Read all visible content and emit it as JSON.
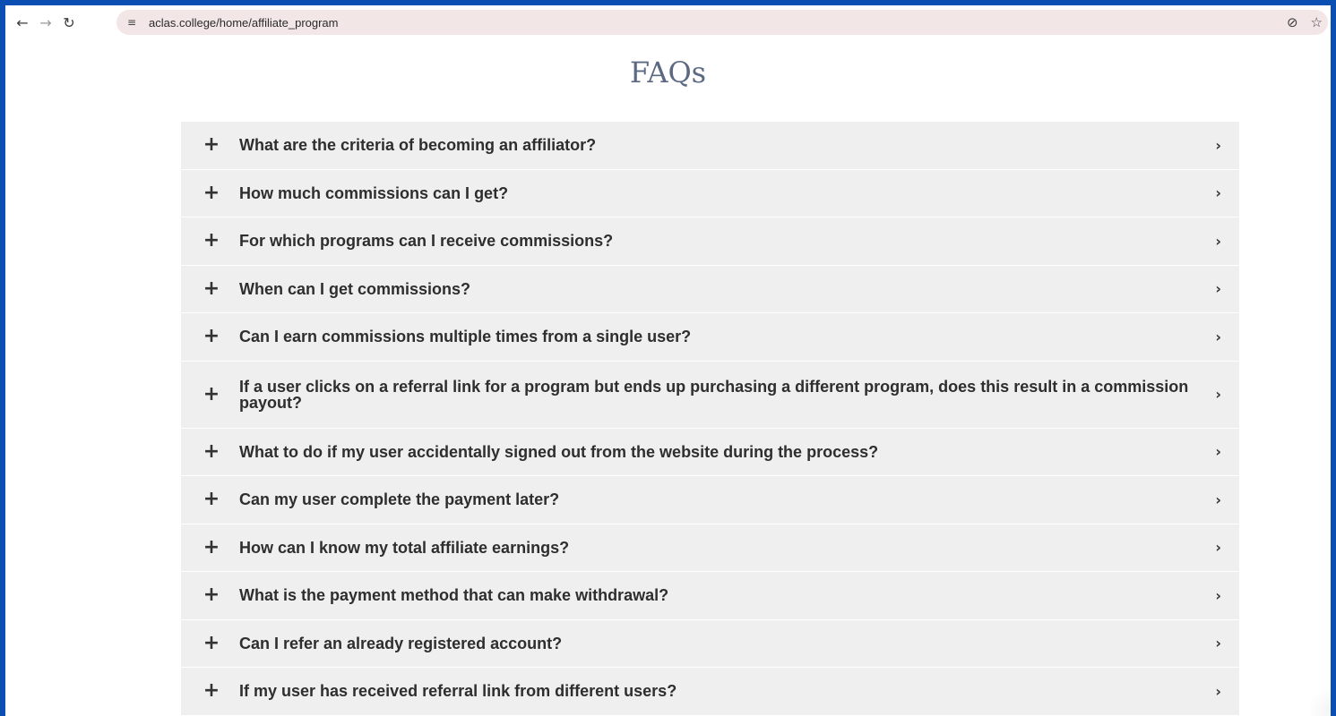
{
  "browser": {
    "url": "aclas.college/home/affiliate_program",
    "icons": {
      "back": "arrow-left-icon",
      "forward": "arrow-right-icon",
      "reload": "reload-icon",
      "site_info": "tune-icon",
      "eye_off": "eye-off-icon",
      "bookmark": "star-icon"
    }
  },
  "page": {
    "title": "FAQs"
  },
  "faqs": [
    {
      "question": "What are the criteria of becoming an affiliator?"
    },
    {
      "question": "How much commissions can I get?"
    },
    {
      "question": "For which programs can I receive commissions?"
    },
    {
      "question": "When can I get commissions?"
    },
    {
      "question": "Can I earn commissions multiple times from a single user?"
    },
    {
      "question": "If a user clicks on a referral link for a program but ends up purchasing a different program, does this result in a commission payout?"
    },
    {
      "question": "What to do if my user accidentally signed out from the website during the process?"
    },
    {
      "question": "Can my user complete the payment later?"
    },
    {
      "question": "How can I know my total affiliate earnings?"
    },
    {
      "question": "What is the payment method that can make withdrawal?"
    },
    {
      "question": "Can I refer an already registered account?"
    },
    {
      "question": "If my user has received referral link from different users?"
    }
  ],
  "colors": {
    "frame": "#0b4fb3",
    "omnibox": "#f2e6e6",
    "title": "#5b6a82",
    "item_bg": "#efefef"
  }
}
